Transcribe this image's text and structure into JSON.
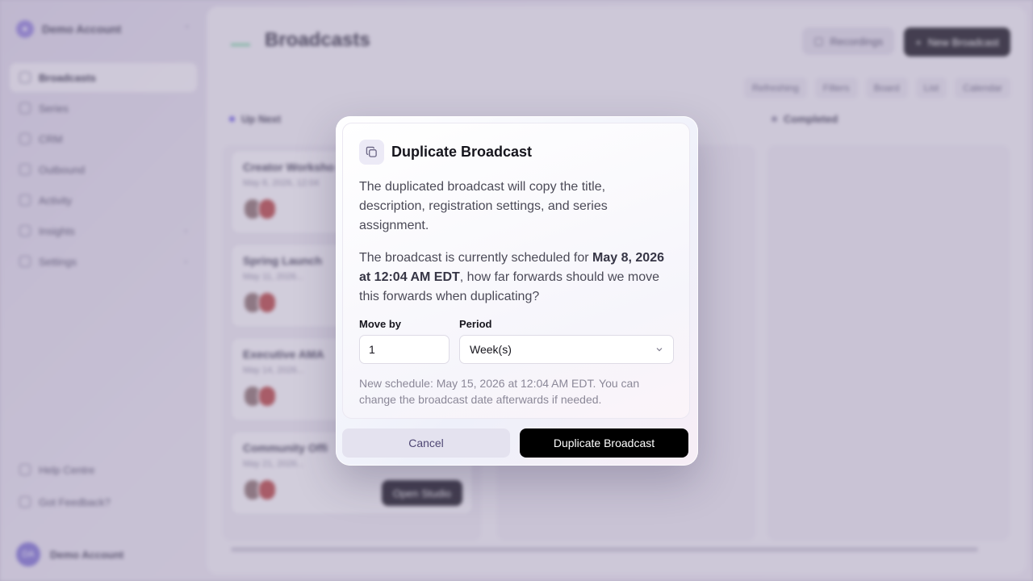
{
  "sidebar": {
    "account_name": "Demo Account",
    "items": [
      {
        "label": "Broadcasts"
      },
      {
        "label": "Series"
      },
      {
        "label": "CRM"
      },
      {
        "label": "Outbound"
      },
      {
        "label": "Activity"
      },
      {
        "label": "Insights"
      },
      {
        "label": "Settings"
      }
    ],
    "bottom_items": [
      {
        "label": "Help Centre"
      },
      {
        "label": "Got Feedback?"
      }
    ],
    "user": {
      "name": "Demo Account",
      "initials": "DA"
    }
  },
  "main": {
    "title": "Broadcasts",
    "recordings_label": "Recordings",
    "new_broadcast_label": "New Broadcast",
    "views": [
      "Refreshing",
      "Filters",
      "Board",
      "List",
      "Calendar"
    ],
    "columns": [
      {
        "label": "Up Next"
      },
      {
        "label": "Completed"
      }
    ],
    "cards": [
      {
        "title": "Creator Worksho",
        "date": "May 8, 2026, 12:04"
      },
      {
        "title": "Spring Launch",
        "date": "May 11, 2026..."
      },
      {
        "title": "Executive AMA",
        "date": "May 14, 2026..."
      },
      {
        "title": "Community Offi",
        "date": "May 21, 2026..."
      }
    ],
    "studio_label": "Open Studio"
  },
  "dialog": {
    "title": "Duplicate Broadcast",
    "description": "The duplicated broadcast will copy the title, description, registration settings, and series assignment.",
    "schedule_prefix": "The broadcast is currently scheduled for ",
    "schedule_date": "May 8, 2026 at 12:04 AM EDT",
    "schedule_suffix": ", how far forwards should we move this forwards when duplicating?",
    "move_by_label": "Move by",
    "move_by_value": "1",
    "period_label": "Period",
    "period_value": "Week(s)",
    "note": "New schedule: May 15, 2026 at 12:04 AM EDT. You can change the broadcast date afterwards if needed.",
    "cancel_label": "Cancel",
    "confirm_label": "Duplicate Broadcast"
  }
}
